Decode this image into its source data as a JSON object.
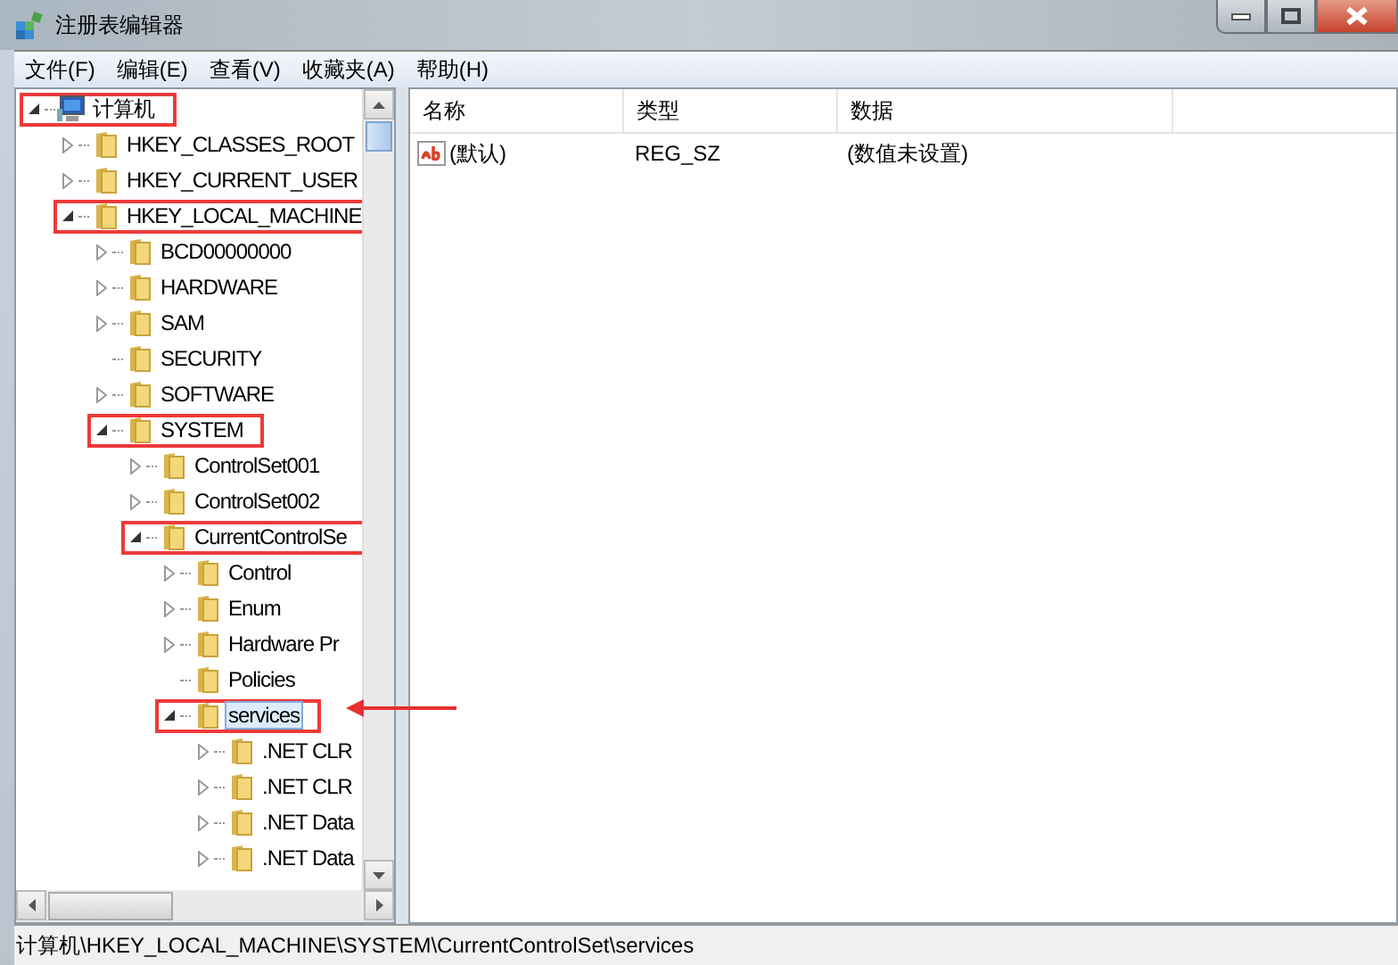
{
  "window": {
    "title": "注册表编辑器"
  },
  "menu": [
    "文件(F)",
    "编辑(E)",
    "查看(V)",
    "收藏夹(A)",
    "帮助(H)"
  ],
  "tree": [
    {
      "label": "计算机",
      "kind": "computer",
      "expanded": true,
      "selected": false,
      "annotated": true,
      "children": [
        {
          "label": "HKEY_CLASSES_ROOT",
          "kind": "folder",
          "expanded": false,
          "selected": false,
          "annotated": false
        },
        {
          "label": "HKEY_CURRENT_USER",
          "kind": "folder",
          "expanded": false,
          "selected": false,
          "annotated": false
        },
        {
          "label": "HKEY_LOCAL_MACHINE",
          "kind": "folder",
          "expanded": true,
          "selected": false,
          "annotated": true,
          "children": [
            {
              "label": "BCD00000000",
              "kind": "folder",
              "expanded": false,
              "selected": false,
              "annotated": false
            },
            {
              "label": "HARDWARE",
              "kind": "folder",
              "expanded": false,
              "selected": false,
              "annotated": false
            },
            {
              "label": "SAM",
              "kind": "folder",
              "expanded": false,
              "selected": false,
              "annotated": false
            },
            {
              "label": "SECURITY",
              "kind": "folder",
              "selected": false,
              "annotated": false
            },
            {
              "label": "SOFTWARE",
              "kind": "folder",
              "expanded": false,
              "selected": false,
              "annotated": false
            },
            {
              "label": "SYSTEM",
              "kind": "folder",
              "expanded": true,
              "selected": false,
              "annotated": true,
              "children": [
                {
                  "label": "ControlSet001",
                  "kind": "folder",
                  "expanded": false,
                  "selected": false,
                  "annotated": false
                },
                {
                  "label": "ControlSet002",
                  "kind": "folder",
                  "expanded": false,
                  "selected": false,
                  "annotated": false
                },
                {
                  "label": "CurrentControlSe",
                  "kind": "folder",
                  "expanded": true,
                  "selected": false,
                  "annotated": true,
                  "children": [
                    {
                      "label": "Control",
                      "kind": "folder",
                      "expanded": false,
                      "selected": false,
                      "annotated": false
                    },
                    {
                      "label": "Enum",
                      "kind": "folder",
                      "expanded": false,
                      "selected": false,
                      "annotated": false
                    },
                    {
                      "label": "Hardware Pr",
                      "kind": "folder",
                      "expanded": false,
                      "selected": false,
                      "annotated": false
                    },
                    {
                      "label": "Policies",
                      "kind": "folder",
                      "selected": false,
                      "annotated": false
                    },
                    {
                      "label": "services",
                      "kind": "folder",
                      "expanded": true,
                      "selected": true,
                      "annotated": true,
                      "children": [
                        {
                          "label": ".NET CLR",
                          "kind": "folder",
                          "expanded": false,
                          "selected": false,
                          "annotated": false
                        },
                        {
                          "label": ".NET CLR",
                          "kind": "folder",
                          "expanded": false,
                          "selected": false,
                          "annotated": false
                        },
                        {
                          "label": ".NET Data",
                          "kind": "folder",
                          "expanded": false,
                          "selected": false,
                          "annotated": false
                        },
                        {
                          "label": ".NET Data",
                          "kind": "folder",
                          "expanded": false,
                          "selected": false,
                          "annotated": false
                        }
                      ]
                    }
                  ]
                }
              ]
            }
          ]
        }
      ]
    }
  ],
  "values": {
    "columns": [
      "名称",
      "类型",
      "数据"
    ],
    "rows": [
      {
        "name": "(默认)",
        "type": "REG_SZ",
        "data": "(数值未设置)"
      }
    ]
  },
  "status_bar": "计算机\\HKEY_LOCAL_MACHINE\\SYSTEM\\CurrentControlSet\\services"
}
